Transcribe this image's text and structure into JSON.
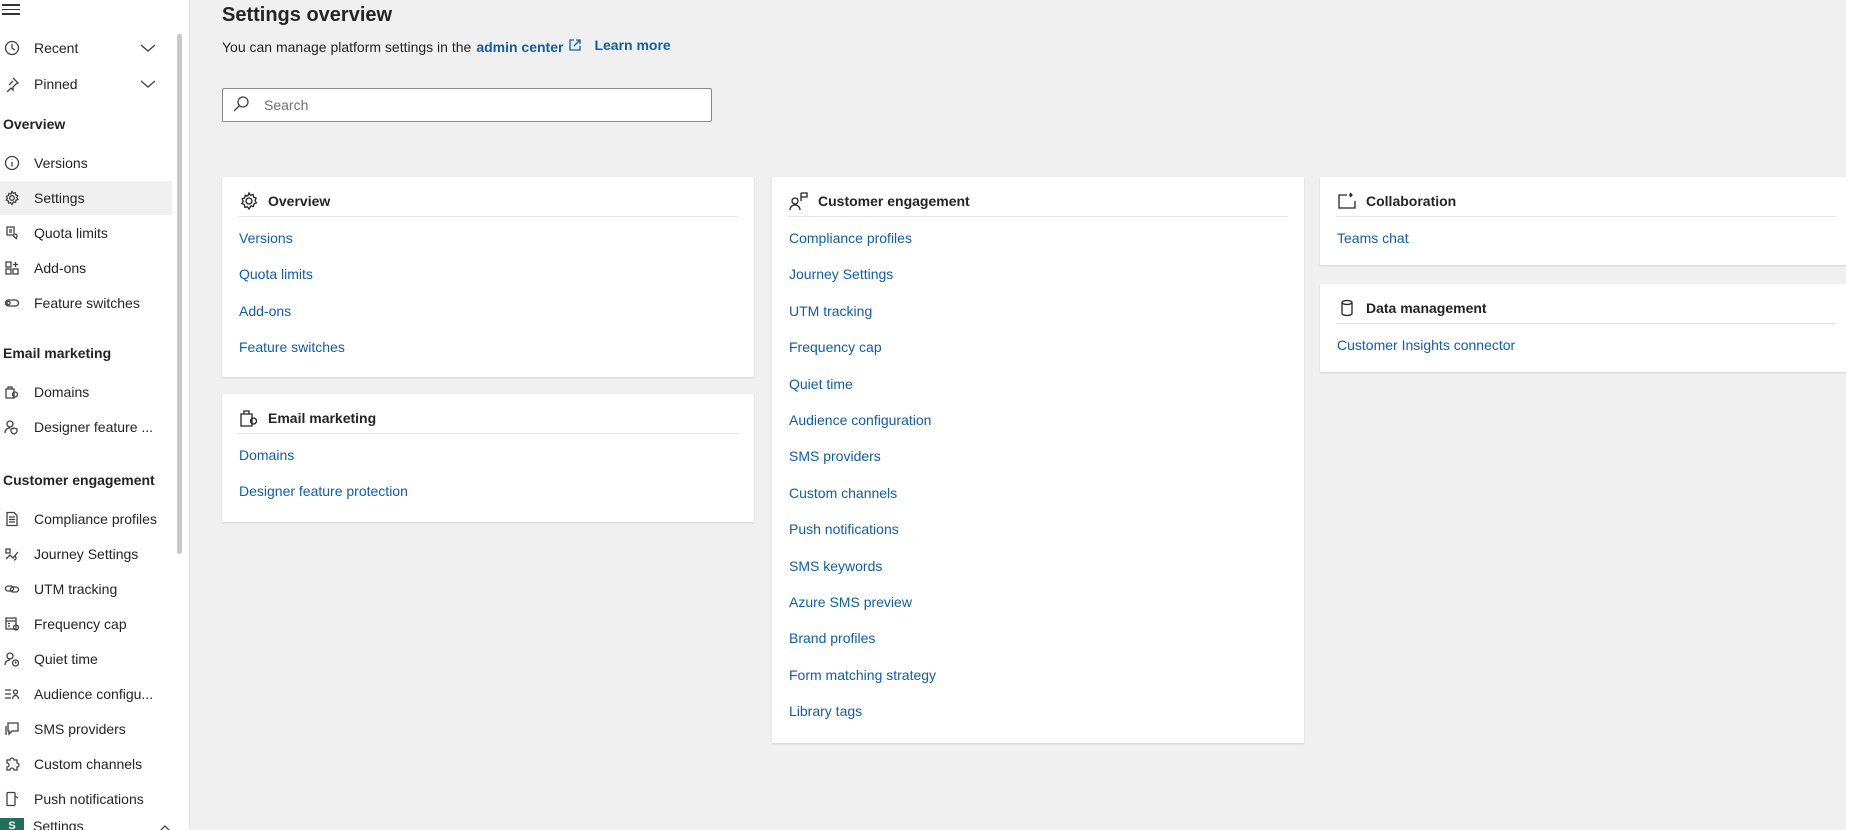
{
  "sidebar": {
    "recent_label": "Recent",
    "pinned_label": "Pinned",
    "sections": {
      "overview": "Overview",
      "email": "Email marketing",
      "customer": "Customer engagement"
    },
    "overview_items": [
      {
        "label": "Versions",
        "icon": "info-icon"
      },
      {
        "label": "Settings",
        "icon": "gear-icon"
      },
      {
        "label": "Quota limits",
        "icon": "quota-icon"
      },
      {
        "label": "Add-ons",
        "icon": "apps-icon"
      },
      {
        "label": "Feature switches",
        "icon": "toggle-icon"
      }
    ],
    "email_items": [
      {
        "label": "Domains",
        "icon": "domain-icon"
      },
      {
        "label": "Designer feature ...",
        "icon": "person-shield-icon"
      }
    ],
    "customer_items": [
      {
        "label": "Compliance profiles",
        "icon": "document-list-icon"
      },
      {
        "label": "Journey Settings",
        "icon": "journey-icon"
      },
      {
        "label": "UTM tracking",
        "icon": "link-icon"
      },
      {
        "label": "Frequency cap",
        "icon": "calendar-icon"
      },
      {
        "label": "Quiet time",
        "icon": "person-clock-icon"
      },
      {
        "label": "Audience configu...",
        "icon": "audience-icon"
      },
      {
        "label": "SMS providers",
        "icon": "chat-icon"
      },
      {
        "label": "Custom channels",
        "icon": "puzzle-icon"
      },
      {
        "label": "Push notifications",
        "icon": "phone-icon"
      }
    ],
    "footer": {
      "badge": "S",
      "label": "Settings"
    }
  },
  "header": {
    "title": "Settings overview",
    "subtitle_text": "You can manage platform settings in the",
    "admin_link": "admin center",
    "learn_more": "Learn more"
  },
  "search": {
    "placeholder": "Search",
    "value": ""
  },
  "cards": {
    "overview": {
      "title": "Overview",
      "links": [
        "Versions",
        "Quota limits",
        "Add-ons",
        "Feature switches"
      ]
    },
    "email": {
      "title": "Email marketing",
      "links": [
        "Domains",
        "Designer feature protection"
      ]
    },
    "customer": {
      "title": "Customer engagement",
      "links": [
        "Compliance profiles",
        "Journey Settings",
        "UTM tracking",
        "Frequency cap",
        "Quiet time",
        "Audience configuration",
        "SMS providers",
        "Custom channels",
        "Push notifications",
        "SMS keywords",
        "Azure SMS preview",
        "Brand profiles",
        "Form matching strategy",
        "Library tags"
      ]
    },
    "collaboration": {
      "title": "Collaboration",
      "links": [
        "Teams chat"
      ]
    },
    "data": {
      "title": "Data management",
      "links": [
        "Customer Insights connector"
      ]
    }
  },
  "colors": {
    "link": "#115ea3",
    "badge": "#1e6f5c",
    "background": "#f0f0f0"
  }
}
